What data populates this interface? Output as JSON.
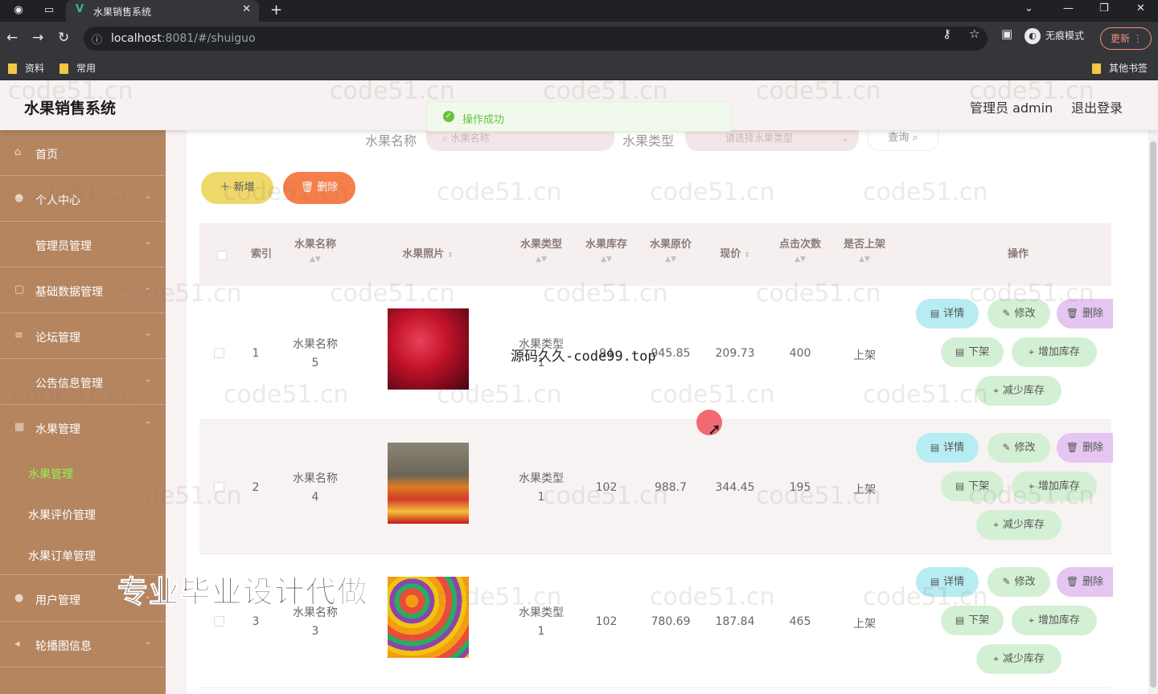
{
  "browser": {
    "tab_title": "水果销售系统",
    "url_host": "localhost",
    "url_path": ":8081/#/shuiguo",
    "incognito_label": "无痕模式",
    "update_label": "更新",
    "bookmarks": [
      "资料",
      "常用"
    ],
    "other_bookmarks": "其他书签"
  },
  "header": {
    "title": "水果销售系统",
    "user": "管理员 admin",
    "logout": "退出登录"
  },
  "toast": {
    "message": "操作成功",
    "type": "success"
  },
  "sidebar": {
    "items": [
      {
        "label": "首页",
        "icon": "home-icon"
      },
      {
        "label": "个人中心",
        "icon": "user-icon"
      },
      {
        "label": "管理员管理",
        "icon": "admin-icon"
      },
      {
        "label": "基础数据管理",
        "icon": "data-icon"
      },
      {
        "label": "论坛管理",
        "icon": "forum-icon"
      },
      {
        "label": "公告信息管理",
        "icon": "notice-icon"
      },
      {
        "label": "水果管理",
        "icon": "fruit-icon"
      }
    ],
    "sub_items": [
      {
        "label": "水果管理",
        "active": true
      },
      {
        "label": "水果评价管理",
        "active": false
      },
      {
        "label": "水果订单管理",
        "active": false
      }
    ],
    "bottom_items": [
      {
        "label": "用户管理",
        "icon": "users-icon"
      },
      {
        "label": "轮播图信息",
        "icon": "carousel-icon"
      }
    ]
  },
  "search": {
    "name_label": "水果名称",
    "name_placeholder": "水果名称",
    "type_label": "水果类型",
    "type_placeholder": "请选择水果类型",
    "query_button": "查询"
  },
  "actions": {
    "add": "新增",
    "delete": "删除"
  },
  "table": {
    "columns": [
      "索引",
      "水果名称",
      "水果照片",
      "水果类型",
      "水果库存",
      "水果原价",
      "现价",
      "点击次数",
      "是否上架",
      "操作"
    ],
    "rows": [
      {
        "index": "1",
        "name_a": "水果名称",
        "name_b": "5",
        "type_a": "水果类型",
        "type_b": "1",
        "stock": "94",
        "price": "945.85",
        "now": "209.73",
        "clicks": "400",
        "status": "上架",
        "image": "pomegranate-photo"
      },
      {
        "index": "2",
        "name_a": "水果名称",
        "name_b": "4",
        "type_a": "水果类型",
        "type_b": "1",
        "stock": "102",
        "price": "988.7",
        "now": "344.45",
        "clicks": "195",
        "status": "上架",
        "image": "fruit-assortment-photo"
      },
      {
        "index": "3",
        "name_a": "水果名称",
        "name_b": "3",
        "type_a": "水果类型",
        "type_b": "1",
        "stock": "102",
        "price": "780.69",
        "now": "187.84",
        "clicks": "465",
        "status": "上架",
        "image": "mixed-fruits-photo"
      }
    ],
    "row_actions": {
      "detail": "详情",
      "edit": "修改",
      "delete": "删除",
      "off_shelf": "下架",
      "add_stock": "增加库存",
      "reduce_stock": "减少库存"
    }
  },
  "overlays": {
    "watermark": "code51.cn",
    "center_text": "源码久久-code99.top",
    "banner": "专业毕业设计代做"
  },
  "colors": {
    "sidebar": "#b58560",
    "active_sub": "#8ef34f",
    "add_button": "#efd86a",
    "delete_button": "#f57e49",
    "success": "#67c23a"
  }
}
